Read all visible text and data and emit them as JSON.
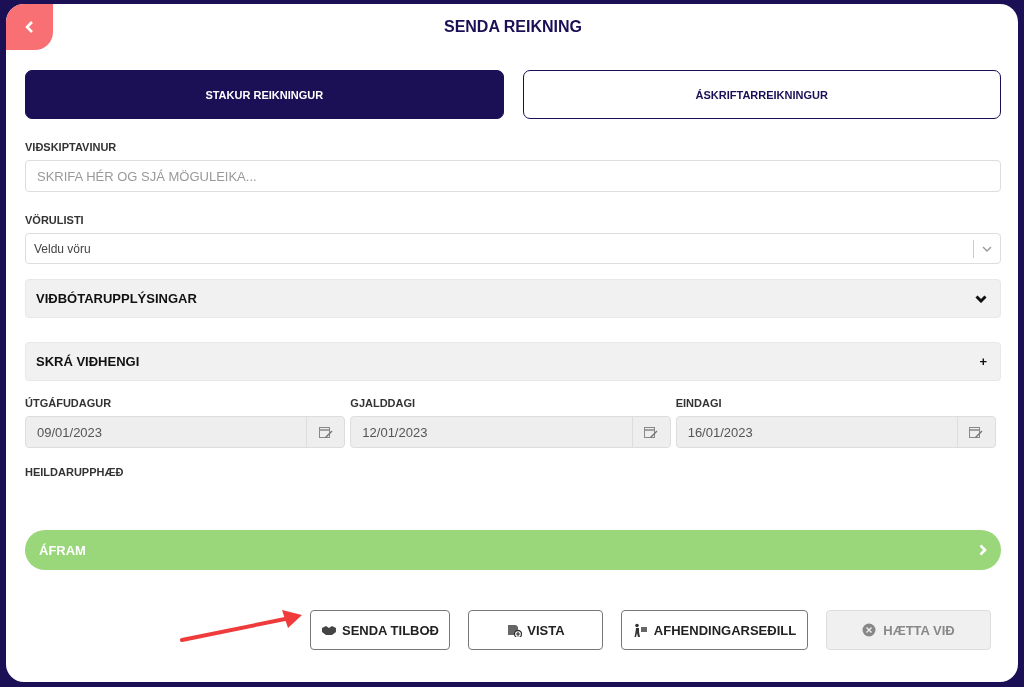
{
  "title": "SENDA REIKNING",
  "tabs": [
    {
      "label": "STAKUR REIKNINGUR",
      "selected": true
    },
    {
      "label": "ÁSKRIFTARREIKNINGUR",
      "selected": false
    }
  ],
  "customer": {
    "label": "VIÐSKIPTAVINUR",
    "placeholder": "SKRIFA HÉR OG SJÁ MÖGULEIKA..."
  },
  "product_list": {
    "label": "VÖRULISTI",
    "placeholder": "Veldu vöru"
  },
  "sections": [
    {
      "title": "VIÐBÓTARUPPLÝSINGAR",
      "kind": "dropdown"
    },
    {
      "title": "SKRÁ VIÐHENGI",
      "kind": "add",
      "symbol": "+"
    }
  ],
  "dates": [
    {
      "label": "ÚTGÁFUDAGUR",
      "value": "09/01/2023"
    },
    {
      "label": "GJALDDAGI",
      "value": "12/01/2023"
    },
    {
      "label": "EINDAGI",
      "value": "16/01/2023"
    }
  ],
  "total": {
    "label": "HEILDARUPPHÆÐ"
  },
  "continue_button": {
    "label": "ÁFRAM"
  },
  "actions": [
    {
      "label": "SENDA TILBOÐ",
      "kind": "offer",
      "disabled": false
    },
    {
      "label": "VISTA",
      "kind": "save",
      "disabled": false
    },
    {
      "label": "AFHENDINGARSEÐILL",
      "kind": "delivery",
      "disabled": false
    },
    {
      "label": "HÆTTA VIÐ",
      "kind": "cancel",
      "disabled": true
    }
  ]
}
